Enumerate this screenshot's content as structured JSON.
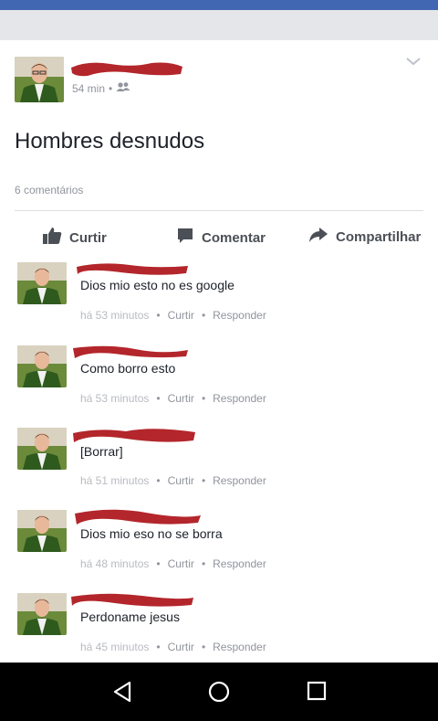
{
  "post": {
    "time": "54 min",
    "separator": "•",
    "privacy_icon": "friends-icon",
    "text": "Hombres desnudos",
    "comments_count": "6 comentários"
  },
  "actions": {
    "like": "Curtir",
    "comment": "Comentar",
    "share": "Compartilhar"
  },
  "comments": [
    {
      "text": "Dios mio esto no es google",
      "time": "há 53 minutos",
      "like": "Curtir",
      "reply": "Responder",
      "sep": "•"
    },
    {
      "text": "Como borro esto",
      "time": "há 53 minutos",
      "like": "Curtir",
      "reply": "Responder",
      "sep": "•"
    },
    {
      "text": "[Borrar]",
      "time": "há 51 minutos",
      "like": "Curtir",
      "reply": "Responder",
      "sep": "•"
    },
    {
      "text": "Dios mio eso no se borra",
      "time": "há 48 minutos",
      "like": "Curtir",
      "reply": "Responder",
      "sep": "•"
    },
    {
      "text": "Perdoname jesus",
      "time": "há 45 minutos",
      "like": "Curtir",
      "reply": "Responder",
      "sep": "•"
    }
  ],
  "colors": {
    "brand": "#4267b2",
    "redaction": "#b3262b"
  }
}
